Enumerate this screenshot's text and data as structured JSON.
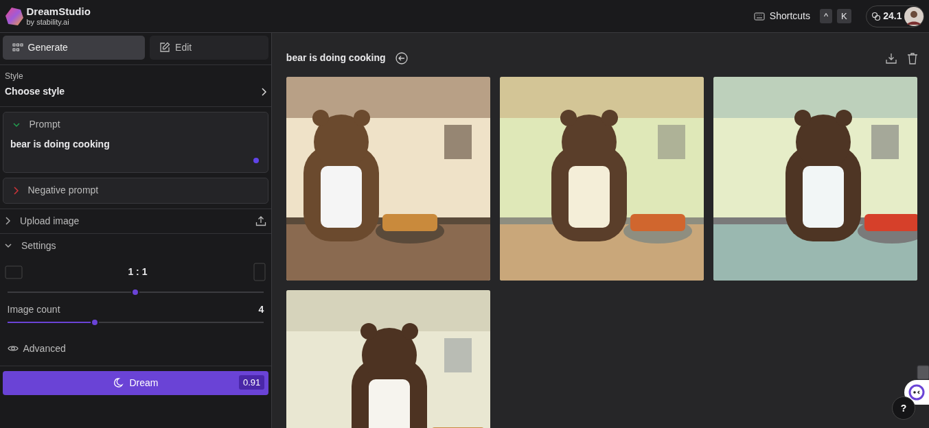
{
  "brand": {
    "name": "DreamStudio",
    "byline": "by stability.ai"
  },
  "header": {
    "shortcuts_label": "Shortcuts",
    "keys": [
      "^",
      "K"
    ],
    "credits": "24.1"
  },
  "mode_tabs": [
    {
      "label": "Generate",
      "kind": "grid",
      "selected": true
    },
    {
      "label": "Edit",
      "kind": "edit",
      "selected": false
    }
  ],
  "style": {
    "label": "Style",
    "value": "Choose style"
  },
  "prompt_sections": [
    {
      "label": "Prompt",
      "expanded": true,
      "color": "#22a050",
      "value": "bear is doing cooking"
    },
    {
      "label": "Negative prompt",
      "expanded": false,
      "color": "#d0343a"
    }
  ],
  "panels": [
    {
      "label": "Upload image",
      "expanded": false,
      "kind": "upload"
    },
    {
      "label": "Settings",
      "expanded": true,
      "kind": "settings"
    }
  ],
  "settings": {
    "aspect": {
      "reading": "1 : 1",
      "level": 0.5
    },
    "image_count": {
      "label": "Image count",
      "reading": "4",
      "level": 0.34
    },
    "advanced": "Advanced"
  },
  "dream_button": {
    "label": "Dream",
    "cost": "0.91"
  },
  "gallery": {
    "title": "bear is doing cooking"
  },
  "help": "?"
}
